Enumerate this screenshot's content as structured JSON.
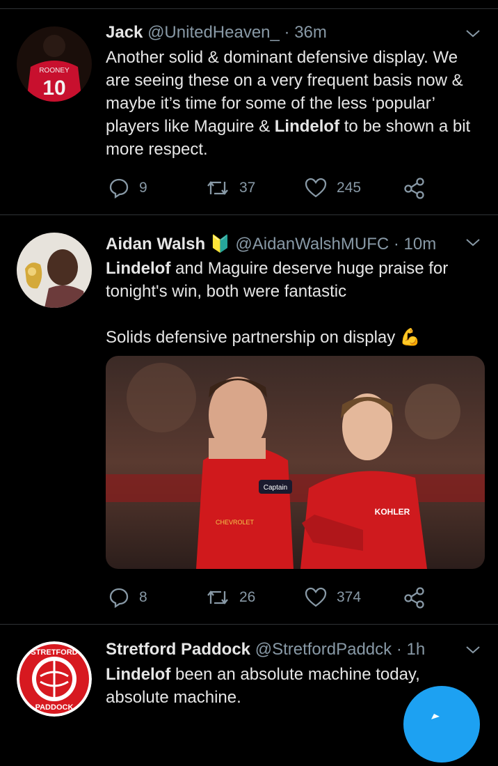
{
  "tweets": [
    {
      "name": "Jack",
      "handle": "@UnitedHeaven_",
      "time": "· 36m",
      "avatar_text": {
        "name": "ROONEY",
        "number": "10"
      },
      "text": {
        "p1": "Another solid & dominant defensive display. We are seeing these on a very frequent basis now & maybe it’s time for some of the less ‘popular’ players like Maguire & ",
        "bold": "Lindelof",
        "p2": " to be shown a bit more respect."
      },
      "replies": "9",
      "retweets": "37",
      "likes": "245"
    },
    {
      "name": "Aidan Walsh",
      "badge": "🔰",
      "handle": "@AidanWalshMUFC",
      "time": "· 10m",
      "text": {
        "bold": "Lindelof",
        "p1": " and Maguire deserve huge praise for tonight's win, both were fantastic",
        "p2": "Solids defensive partnership on display",
        "emoji": "💪"
      },
      "media": {
        "sleeve1": "Captain",
        "sponsor": "KOHLER",
        "badge_text": "KOHLER",
        "chevrolet": "CHEVROLET"
      },
      "replies": "8",
      "retweets": "26",
      "likes": "374"
    },
    {
      "name": "Stretford Paddock",
      "handle": "@StretfordPaddck",
      "time": "· 1h",
      "avatar_text": {
        "top": "STRETFORD",
        "bottom": "PADDOCK"
      },
      "text": {
        "bold": "Lindelof",
        "p1": " been an absolute machine today, absolute machine."
      }
    }
  ],
  "colors": {
    "background": "#000000",
    "secondary_text": "#8899a6",
    "accent": "#1da1f2",
    "divider": "#2f3336"
  },
  "icons": [
    "chevron-down-icon",
    "reply-icon",
    "retweet-icon",
    "like-icon",
    "share-icon",
    "compose-icon"
  ]
}
